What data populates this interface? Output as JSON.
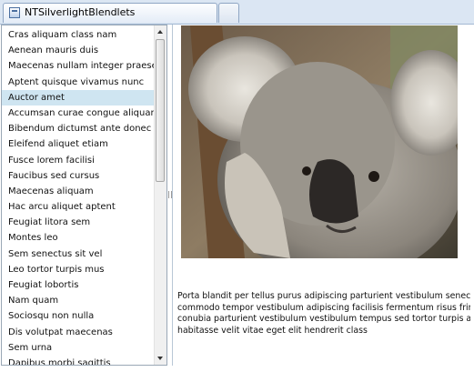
{
  "window": {
    "tab_title": "NTSilverlightBlendlets",
    "tab_icon": "window-icon",
    "new_tab_icon": "new-tab-icon"
  },
  "list": {
    "selected_index": 4,
    "scroll_position": 0.0,
    "items": [
      "Cras aliquam class nam",
      "Aenean mauris duis",
      "Maecenas nullam integer praesent",
      "Aptent quisque vivamus nunc",
      "Auctor amet",
      "Accumsan curae congue aliquam",
      "Bibendum dictumst ante donec",
      "Eleifend aliquet etiam",
      "Fusce lorem facilisi",
      "Faucibus sed cursus",
      "Maecenas aliquam",
      "Hac arcu aliquet aptent",
      "Feugiat litora sem",
      "Montes leo",
      "Sem senectus sit vel",
      "Leo tortor turpis mus",
      "Feugiat lobortis",
      "Nam quam",
      "Sociosqu non nulla",
      "Dis volutpat maecenas",
      "Sem urna",
      "Dapibus morbi sagittis"
    ]
  },
  "detail": {
    "image": "koala-photo",
    "paragraph_lines": [
      "Porta blandit per tellus purus adipiscing parturient vestibulum senectus",
      "commodo tempor vestibulum adipiscing facilisis fermentum risus fringill",
      "conubia parturient vestibulum vestibulum tempus sed tortor turpis adip",
      "habitasse velit vitae eget elit hendrerit class"
    ]
  },
  "colors": {
    "selection": "#cfe5f1",
    "tabstrip": "#dbe6f3",
    "border": "#9aa8b6"
  }
}
